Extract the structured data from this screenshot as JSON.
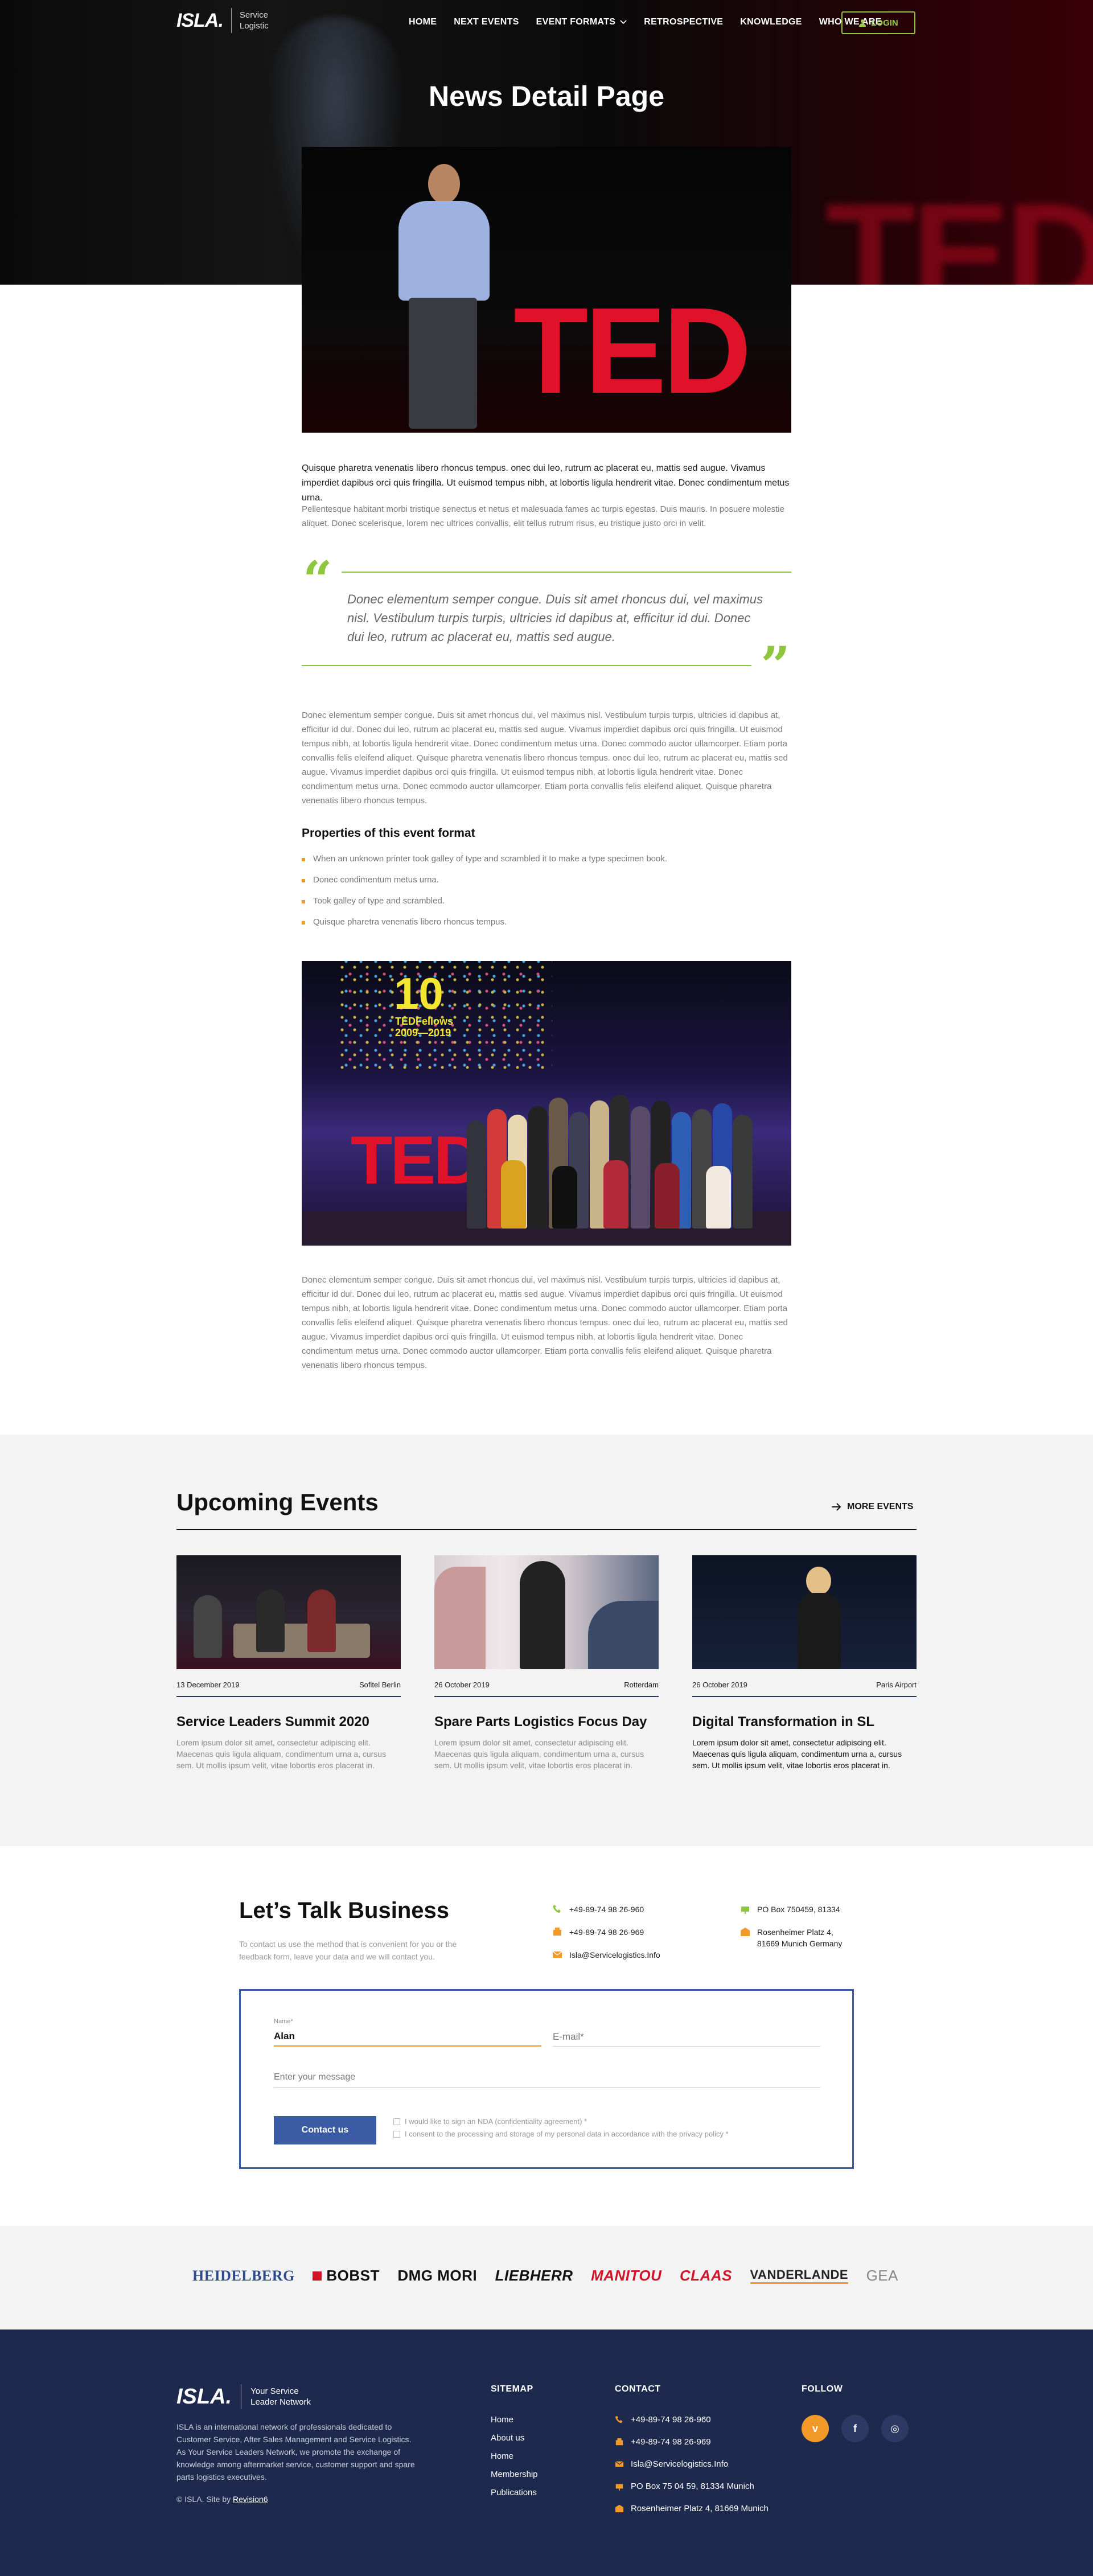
{
  "header": {
    "logo": "ISLA.",
    "logo_tagline": "Service\nLogistic",
    "nav": [
      "HOME",
      "NEXT EVENTS",
      "EVENT FORMATS",
      "RETROSPECTIVE",
      "KNOWLEDGE",
      "WHO WE ARE"
    ],
    "login_label": "LOGIN"
  },
  "page_title": "News Detail Page",
  "article": {
    "lead": "Quisque pharetra venenatis libero rhoncus tempus. onec dui leo, rutrum ac placerat eu, mattis sed augue. Vivamus imperdiet dapibus orci quis fringilla. Ut euismod tempus nibh, at lobortis ligula hendrerit vitae. Donec condimentum metus urna.",
    "p1": "Pellentesque habitant morbi tristique senectus et netus et malesuada fames ac turpis egestas. Duis mauris. In posuere molestie aliquet. Donec scelerisque, lorem nec ultrices convallis, elit tellus rutrum risus, eu tristique justo orci in velit.",
    "quote": "Donec elementum semper congue. Duis sit amet rhoncus dui, vel maximus nisl. Vestibulum turpis turpis, ultricies id dapibus at, efficitur id dui. Donec dui leo, rutrum ac placerat eu, mattis sed augue.",
    "p2": "Donec elementum semper congue. Duis sit amet rhoncus dui, vel maximus nisl. Vestibulum turpis turpis, ultricies id dapibus at, efficitur id dui. Donec dui leo, rutrum ac placerat eu, mattis sed augue. Vivamus imperdiet dapibus orci quis fringilla. Ut euismod tempus nibh, at lobortis ligula hendrerit vitae. Donec condimentum metus urna. Donec commodo auctor ullamcorper. Etiam porta convallis felis eleifend aliquet. Quisque pharetra venenatis libero rhoncus tempus. onec dui leo, rutrum ac placerat eu, mattis sed augue. Vivamus imperdiet dapibus orci quis fringilla. Ut euismod tempus nibh, at lobortis ligula hendrerit vitae. Donec condimentum metus urna. Donec commodo auctor ullamcorper. Etiam porta convallis felis eleifend aliquet. Quisque pharetra venenatis libero rhoncus tempus.",
    "props_title": "Properties of this event format",
    "bullets": [
      "When an unknown printer took  galley of type and scrambled it to make a type specimen book.",
      "Donec condimentum metus urna.",
      "Took  galley of type and scrambled.",
      "Quisque pharetra venenatis libero rhoncus tempus."
    ],
    "img_ted": "TED",
    "img_ten": "10",
    "img_ten_sub": "TEDFellows\n2009—2019",
    "p3": "Donec elementum semper congue. Duis sit amet rhoncus dui, vel maximus nisl. Vestibulum turpis turpis, ultricies id dapibus at, efficitur id dui. Donec dui leo, rutrum ac placerat eu, mattis sed augue. Vivamus imperdiet dapibus orci quis fringilla. Ut euismod tempus nibh, at lobortis ligula hendrerit vitae. Donec condimentum metus urna. Donec commodo auctor ullamcorper. Etiam porta convallis felis eleifend aliquet. Quisque pharetra venenatis libero rhoncus tempus. onec dui leo, rutrum ac placerat eu, mattis sed augue. Vivamus imperdiet dapibus orci quis fringilla. Ut euismod tempus nibh, at lobortis ligula hendrerit vitae. Donec condimentum metus urna. Donec commodo auctor ullamcorper. Etiam porta convallis felis eleifend aliquet. Quisque pharetra venenatis libero rhoncus tempus."
  },
  "events": {
    "title": "Upcoming Events",
    "more_label": "MORE EVENTS",
    "items": [
      {
        "date": "13 December 2019",
        "location": "Sofitel Berlin",
        "title": "Service Leaders Summit 2020",
        "desc": "Lorem ipsum dolor sit amet, consectetur adipiscing elit. Maecenas quis ligula aliquam, condimentum urna a, cursus sem. Ut mollis ipsum velit, vitae lobortis eros placerat in."
      },
      {
        "date": "26 October 2019",
        "location": "Rotterdam",
        "title": "Spare Parts Logistics Focus Day",
        "desc": "Lorem ipsum dolor sit amet, consectetur adipiscing elit. Maecenas quis ligula aliquam, condimentum urna a, cursus sem. Ut mollis ipsum velit, vitae lobortis eros placerat in."
      },
      {
        "date": "26 October 2019",
        "location": "Paris Airport",
        "title": "Digital Transformation in SL",
        "desc": "Lorem ipsum dolor sit amet, consectetur adipiscing elit. Maecenas quis ligula aliquam, condimentum urna a, cursus sem. Ut mollis ipsum velit, vitae lobortis eros placerat in."
      }
    ]
  },
  "contact": {
    "title": "Let’s Talk Business",
    "subtitle": "To contact us use the method that is convenient for you or the feedback form, leave your data and we will contact you.",
    "phone1": "+49-89-74 98 26-960",
    "phone2": "+49-89-74 98 26-969",
    "email": "Isla@Servicelogistics.Info",
    "pobox": "PO Box 750459, 81334",
    "address": "Rosenheimer Platz 4,\n81669 Munich Germany",
    "form": {
      "name_label": "Name*",
      "name_value": "Alan",
      "email_placeholder": "E-mail*",
      "message_placeholder": "Enter your message",
      "submit_label": "Contact us",
      "check_nda": "I would like to sign an NDA (confidentiality agreement) *",
      "check_consent": "I consent to the processing and storage of my personal data in accordance with the privacy policy *"
    }
  },
  "brands": [
    "HEIDELBERG",
    "BOBST",
    "DMG MORI",
    "LIEBHERR",
    "MANITOU",
    "CLAAS",
    "VANDERLANDE",
    "GEA"
  ],
  "footer": {
    "logo": "ISLA.",
    "logo_tagline": "Your Service\nLeader Network",
    "about": "ISLA is an international network of professionals dedicated to Customer Service, After Sales Management and Service Logistics. As Your Service Leaders Network, we promote the exchange of knowledge among aftermarket service, customer support and spare parts logistics executives.",
    "copy_prefix": "© ISLA. Site by ",
    "copy_link": "Revision6",
    "sitemap_title": "SITEMAP",
    "sitemap": [
      "Home",
      "About us",
      "Home",
      "Membership",
      "Publications"
    ],
    "contact_title": "CONTACT",
    "contact": [
      "+49-89-74 98 26-960",
      "+49-89-74 98 26-969",
      "Isla@Servicelogistics.Info",
      "PO Box 75 04 59, 81334 Munich",
      "Rosenheimer Platz 4, 81669 Munich"
    ],
    "follow_title": "FOLLOW",
    "social": [
      "v",
      "f",
      "◎"
    ]
  },
  "colors": {
    "accent_green": "#8fc63f",
    "accent_orange": "#f19a2a",
    "brand_blue": "#3b5ba5",
    "footer_navy": "#1e2a4d",
    "ted_red": "#e0122a"
  }
}
